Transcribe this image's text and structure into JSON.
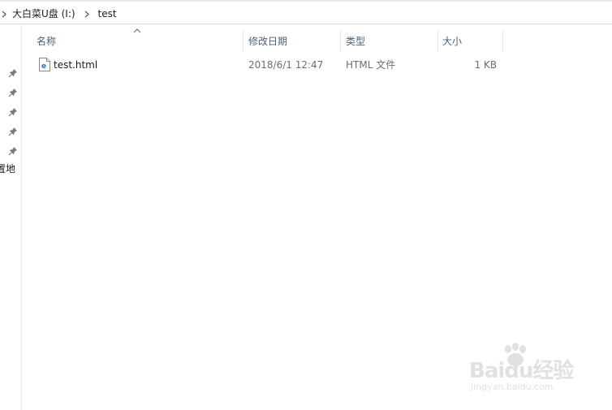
{
  "breadcrumb": {
    "items": [
      "大白菜U盘 (I:)",
      "test"
    ]
  },
  "nav_pane": {
    "pinned_count": 5,
    "partial_label": "置地"
  },
  "columns": {
    "name": "名称",
    "modified": "修改日期",
    "type": "类型",
    "size": "大小"
  },
  "files": [
    {
      "name": "test.html",
      "modified": "2018/6/1 12:47",
      "type": "HTML 文件",
      "size": "1 KB",
      "icon": "html-file-icon"
    }
  ],
  "watermark": {
    "main": "Baidu经验",
    "sub": "jingyan.baidu.com"
  },
  "colors": {
    "header_text": "#4c607a",
    "secondary_text": "#6d6d6d",
    "icon_blue": "#1e6fd1"
  }
}
